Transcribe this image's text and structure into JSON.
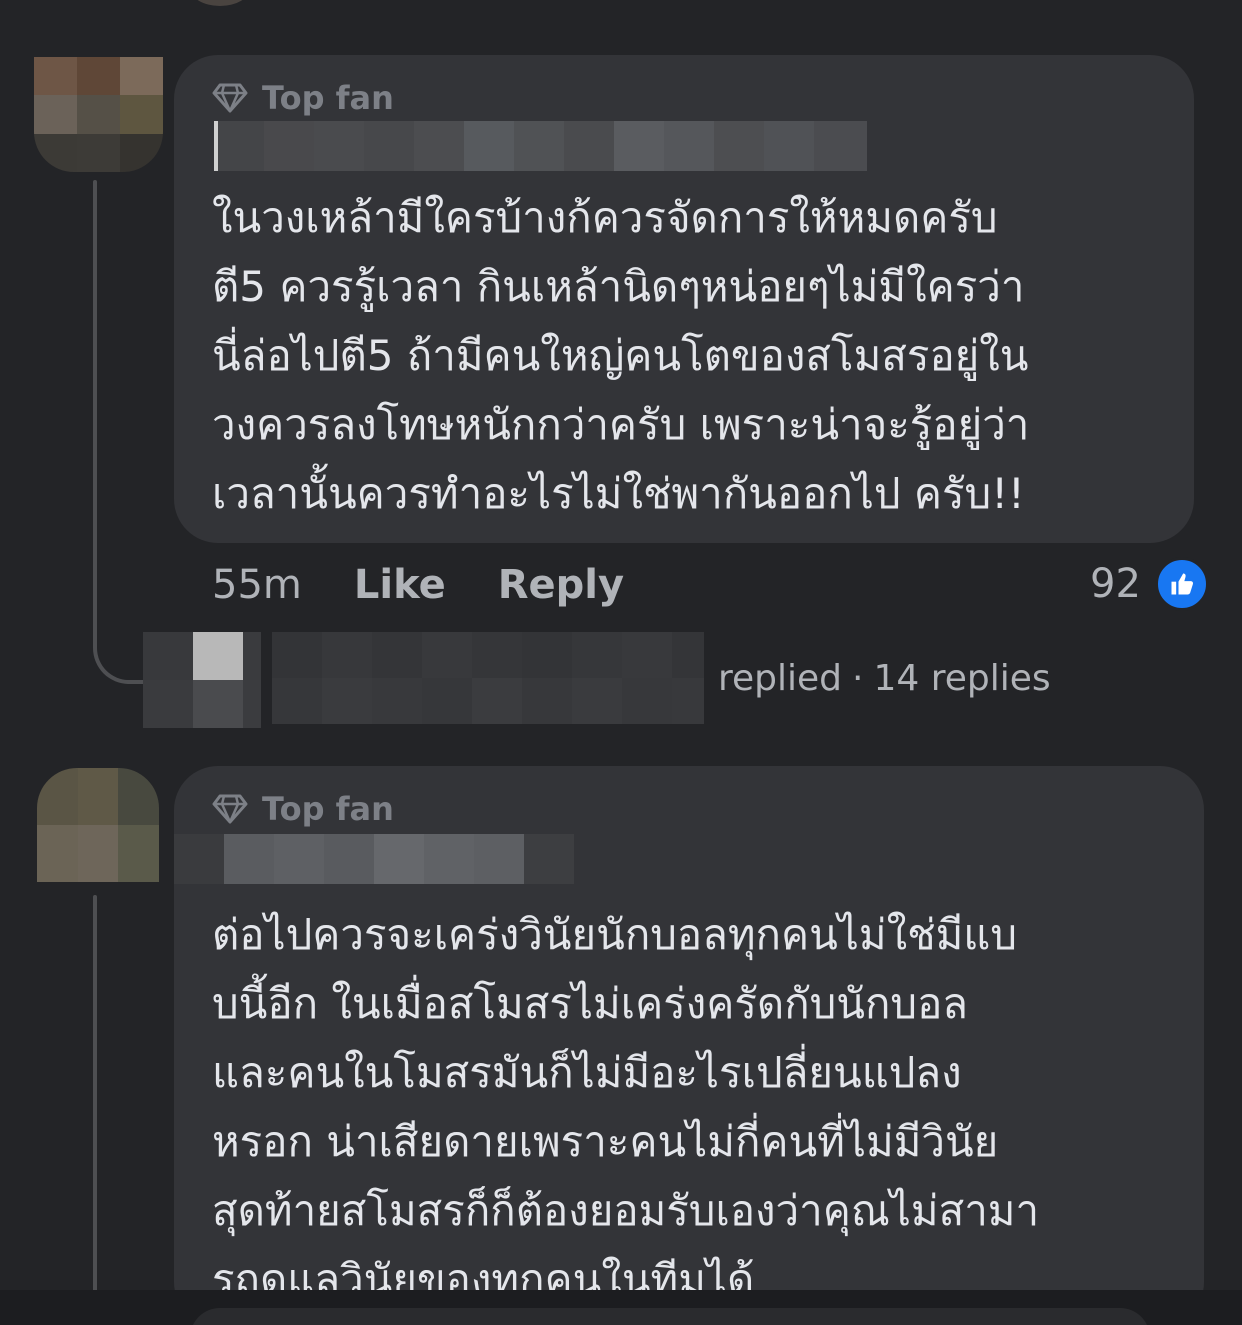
{
  "comments": [
    {
      "badge": "Top fan",
      "text": "ในวงเหล้ามีใครบ้างก้ควรจัดการให้หมดครับ\nตี5 ควรรู้เวลา กินเหล้านิดๆหน่อยๆไม่มีใครว่า\nนี่ล่อไปตี5 ถ้ามีคนใหญ่คนโตของสโมสรอยู่ใน\nวงควรลงโทษหนักกว่าครับ  เพราะน่าจะรู้อยู่ว่า\nเวลานั้นควรทำอะไรไม่ใช่พากันออกไป ครับ!!",
      "time": "55m",
      "like_label": "Like",
      "reply_label": "Reply",
      "reaction_count": "92",
      "reaction_icon": "thumbs-up-icon",
      "replies_summary": {
        "replied_text": "replied",
        "separator": "·",
        "count_text": "14 replies"
      }
    },
    {
      "badge": "Top fan",
      "text": "ต่อไปควรจะเคร่งวินัยนักบอลทุกคนไม่ใช่มีแบ\nบนี้อีก  ในเมื่อสโมสรไม่เคร่งครัดกับนักบอล\nและคนในโมสรมันก็ไม่มีอะไรเปลี่ยนแปลง\nหรอก น่าเสียดายเพราะคนไม่กี่คนที่ไม่มีวินัย\nสุดท้ายสโมสรก็ก็ต้องยอมรับเองว่าคุณไม่สามา\nรถดแลวินัยของทุกคนในทีมได้"
    }
  ],
  "colors": {
    "background": "#232427",
    "bubble": "#333438",
    "text": "#e4e6eb",
    "secondary_text": "#b0b3b8",
    "badge": "#7d8087",
    "like_blue": "#1877f2"
  }
}
